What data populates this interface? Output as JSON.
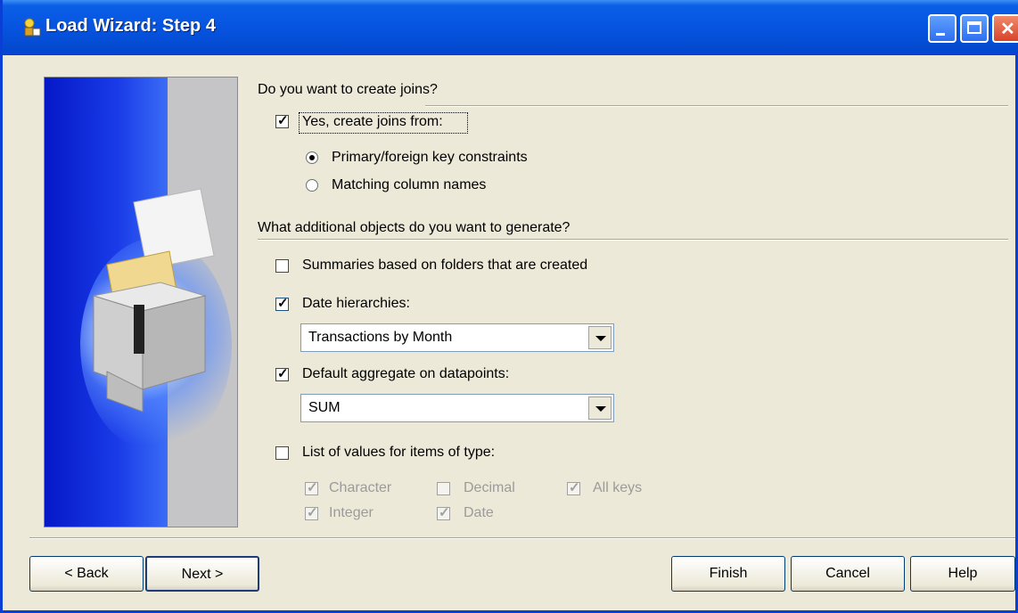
{
  "window": {
    "title": "Load Wizard: Step 4"
  },
  "joins": {
    "question": "Do you want to create joins?",
    "create_joins": {
      "label": "Yes, create joins from:",
      "checked": true
    },
    "options": [
      {
        "label": "Primary/foreign key constraints",
        "selected": true
      },
      {
        "label": "Matching column names",
        "selected": false
      }
    ]
  },
  "objects": {
    "question": "What additional objects do you want to generate?",
    "summaries": {
      "label": "Summaries based on folders that are created",
      "checked": false
    },
    "date_hierarchies": {
      "label": "Date hierarchies:",
      "checked": true,
      "value": "Transactions by Month"
    },
    "default_aggregate": {
      "label": "Default aggregate on datapoints:",
      "checked": true,
      "value": "SUM"
    },
    "list_of_values": {
      "label": "List of values for items of type:",
      "checked": false,
      "types": [
        {
          "label": "Character",
          "checked": true
        },
        {
          "label": "Decimal",
          "checked": false
        },
        {
          "label": "All keys",
          "checked": true
        },
        {
          "label": "Integer",
          "checked": true
        },
        {
          "label": "Date",
          "checked": true
        }
      ]
    }
  },
  "buttons": {
    "back": "< Back",
    "next": "Next >",
    "finish": "Finish",
    "cancel": "Cancel",
    "help": "Help"
  }
}
